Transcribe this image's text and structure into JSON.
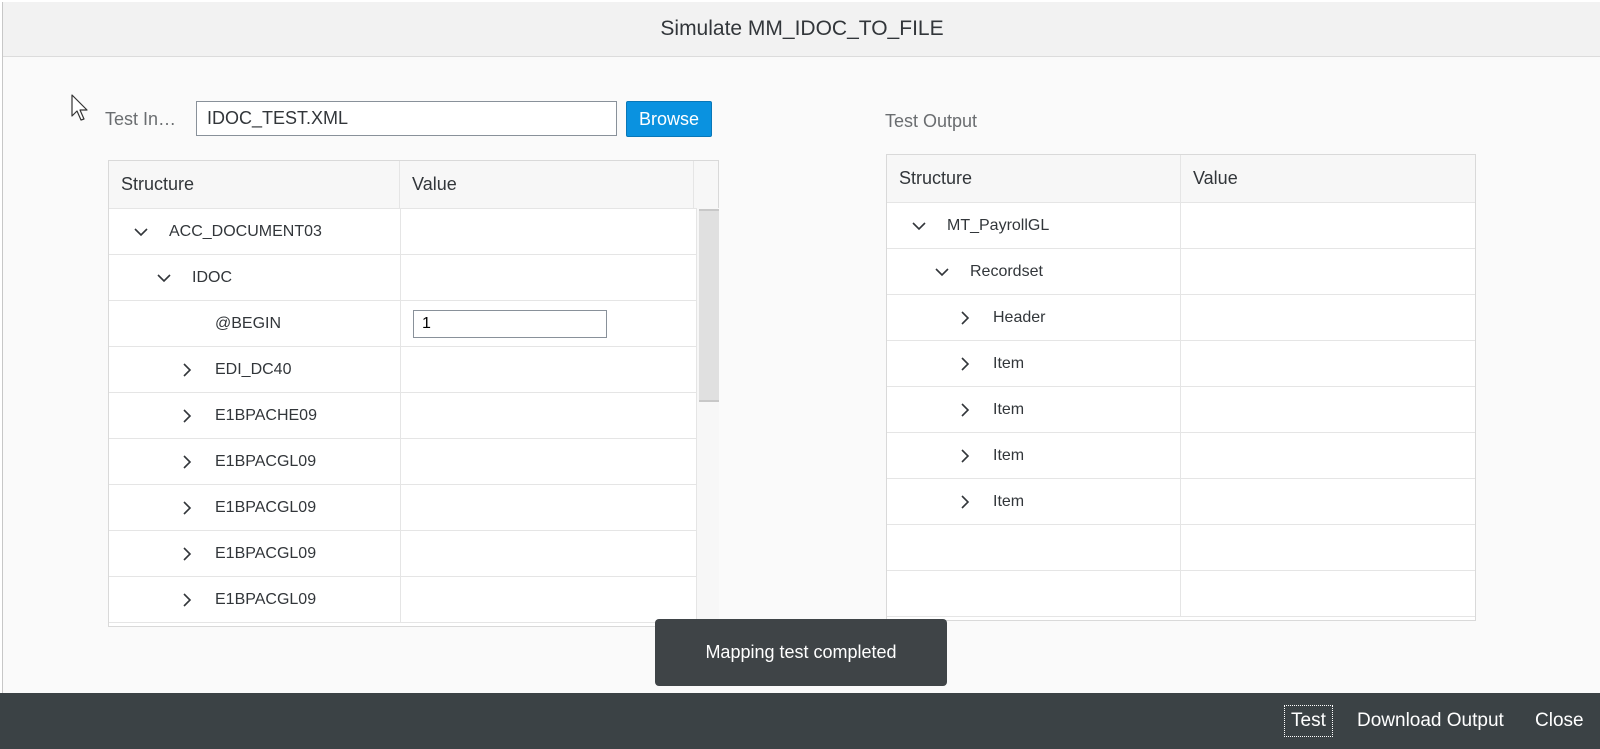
{
  "dialog": {
    "title": "Simulate MM_IDOC_TO_FILE"
  },
  "test_input": {
    "label": "Test In…",
    "file_value": "IDOC_TEST.XML",
    "browse_label": "Browse",
    "grid": {
      "col_structure": "Structure",
      "col_value": "Value",
      "rows": [
        {
          "name": "ACC_DOCUMENT03",
          "level": 0,
          "toggle": "expanded",
          "value": ""
        },
        {
          "name": "IDOC",
          "level": 1,
          "toggle": "expanded",
          "value": ""
        },
        {
          "name": "@BEGIN",
          "level": 2,
          "toggle": "none",
          "value": "1"
        },
        {
          "name": "EDI_DC40",
          "level": 2,
          "toggle": "collapsed",
          "value": ""
        },
        {
          "name": "E1BPACHE09",
          "level": 2,
          "toggle": "collapsed",
          "value": ""
        },
        {
          "name": "E1BPACGL09",
          "level": 2,
          "toggle": "collapsed",
          "value": ""
        },
        {
          "name": "E1BPACGL09",
          "level": 2,
          "toggle": "collapsed",
          "value": ""
        },
        {
          "name": "E1BPACGL09",
          "level": 2,
          "toggle": "collapsed",
          "value": ""
        },
        {
          "name": "E1BPACGL09",
          "level": 2,
          "toggle": "collapsed",
          "value": ""
        }
      ]
    }
  },
  "test_output": {
    "label": "Test Output",
    "grid": {
      "col_structure": "Structure",
      "col_value": "Value",
      "rows": [
        {
          "name": "MT_PayrollGL",
          "level": 0,
          "toggle": "expanded"
        },
        {
          "name": "Recordset",
          "level": 1,
          "toggle": "expanded"
        },
        {
          "name": "Header",
          "level": 2,
          "toggle": "collapsed"
        },
        {
          "name": "Item",
          "level": 2,
          "toggle": "collapsed"
        },
        {
          "name": "Item",
          "level": 2,
          "toggle": "collapsed"
        },
        {
          "name": "Item",
          "level": 2,
          "toggle": "collapsed"
        },
        {
          "name": "Item",
          "level": 2,
          "toggle": "collapsed"
        },
        {
          "name": "",
          "level": 0,
          "toggle": "none"
        },
        {
          "name": "",
          "level": 0,
          "toggle": "none"
        }
      ]
    }
  },
  "toast": {
    "message": "Mapping test completed"
  },
  "footer": {
    "test_label": "Test",
    "download_label": "Download Output",
    "close_label": "Close"
  },
  "icons": {
    "expanded": "chevron-down-icon",
    "collapsed": "chevron-right-icon",
    "cursor": "mouse-pointer-icon"
  }
}
